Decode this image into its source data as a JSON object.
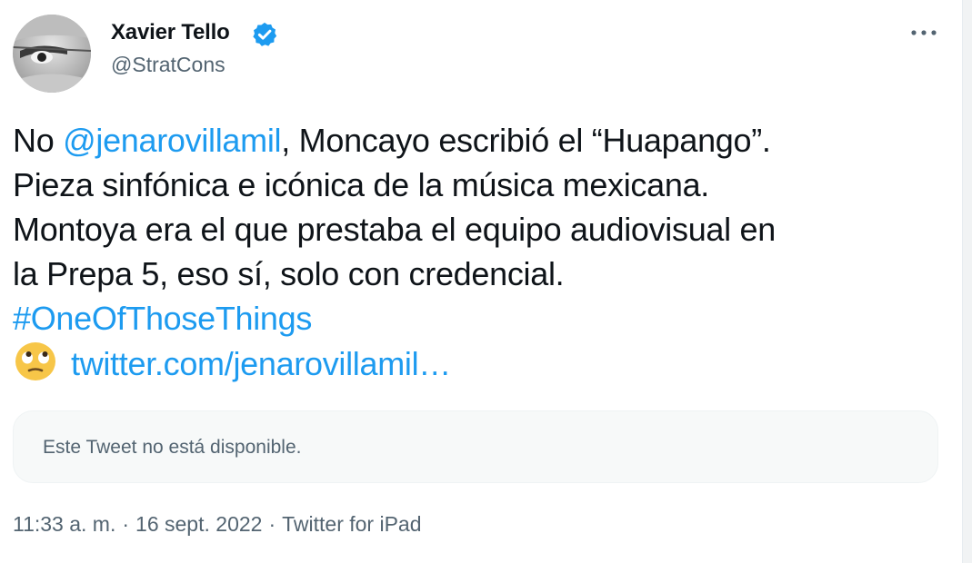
{
  "author": {
    "name": "Xavier Tello",
    "handle": "@StratCons",
    "verified": true,
    "avatar_icon": "avatar-photo"
  },
  "more_icon": "more-horizontal-icon",
  "tweet": {
    "prefix": "No ",
    "mention": "@jenarovillamil",
    "line1_rest": ", Moncayo escribió el “Huapango”.",
    "line2": "Pieza sinfónica e icónica de la música mexicana.",
    "line3": "Montoya era el que prestaba el equipo audiovisual en",
    "line4": "la Prepa 5, eso sí, solo con credencial.",
    "hashtag": "#OneOfThoseThings",
    "emoji_icon": "face-with-rolling-eyes-emoji",
    "link": "twitter.com/jenarovillamil…"
  },
  "quoted": {
    "unavailable_text": "Este Tweet no está disponible."
  },
  "meta": {
    "time": "11:33 a. m.",
    "separator": "·",
    "date": "16 sept. 2022",
    "source": "Twitter for iPad"
  },
  "colors": {
    "link": "#1d9bf0",
    "text": "#0f1419",
    "secondary": "#536471",
    "card_bg": "#f7f9f9"
  }
}
